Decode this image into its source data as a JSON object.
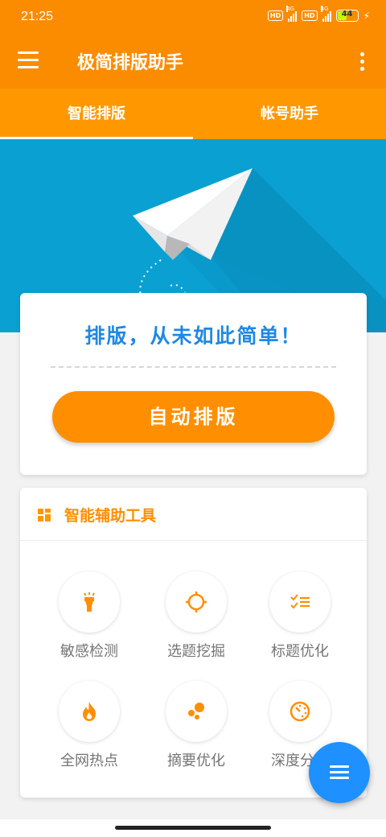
{
  "status_bar": {
    "time": "21:25",
    "hd_label": "HD",
    "network_label": "4G",
    "battery": "44",
    "battery_level": 0.44
  },
  "app_bar": {
    "title": "极简排版助手",
    "menu_icon": "hamburger-menu-icon",
    "more_icon": "more-vertical-icon"
  },
  "tabs": [
    {
      "label": "智能排版",
      "active": true
    },
    {
      "label": "帐号助手",
      "active": false
    }
  ],
  "main_card": {
    "slogan": "排版，从未如此简单！",
    "button_label": "自动排版"
  },
  "tools": {
    "title": "智能辅助工具",
    "items": [
      {
        "label": "敏感检测",
        "icon": "flashlight-icon"
      },
      {
        "label": "选题挖掘",
        "icon": "crosshair-icon"
      },
      {
        "label": "标题优化",
        "icon": "checklist-icon"
      },
      {
        "label": "全网热点",
        "icon": "flame-icon"
      },
      {
        "label": "摘要优化",
        "icon": "bubbles-icon"
      },
      {
        "label": "深度分析",
        "icon": "timer-icon"
      }
    ]
  },
  "colors": {
    "primary": "#fb8c00",
    "tab_bar": "#ff9800",
    "banner": "#0aa0d2",
    "slogan": "#1e88e5",
    "fab": "#1e90ff"
  }
}
